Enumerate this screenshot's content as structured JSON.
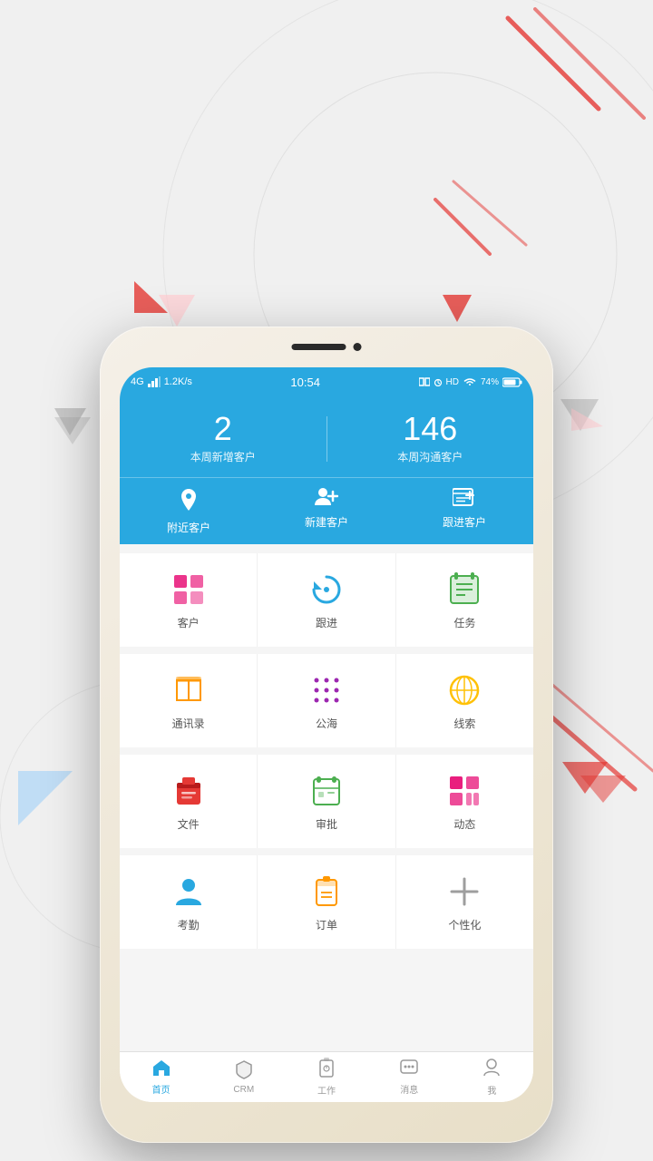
{
  "background": {
    "color": "#efefef"
  },
  "status_bar": {
    "network": "4G",
    "signal": "il",
    "speed": "1.2K/s",
    "time": "10:54",
    "battery": "74%",
    "wifi": "HD"
  },
  "stats": {
    "left_number": "2",
    "left_label": "本周新增客户",
    "right_number": "146",
    "right_label": "本周沟通客户"
  },
  "quick_actions": [
    {
      "id": "nearby",
      "label": "附近客户",
      "icon": "📍"
    },
    {
      "id": "new_customer",
      "label": "新建客户",
      "icon": "👥"
    },
    {
      "id": "follow",
      "label": "跟进客户",
      "icon": "📋"
    }
  ],
  "grid_rows": [
    [
      {
        "id": "customer",
        "label": "客户",
        "color": "#e91e7e",
        "icon": "grid"
      },
      {
        "id": "follow_up",
        "label": "跟进",
        "color": "#29a8e0",
        "icon": "refresh"
      },
      {
        "id": "task",
        "label": "任务",
        "color": "#4caf50",
        "icon": "task"
      }
    ],
    [
      {
        "id": "contacts",
        "label": "通讯录",
        "color": "#ff9800",
        "icon": "book"
      },
      {
        "id": "public_sea",
        "label": "公海",
        "color": "#9c27b0",
        "icon": "dots"
      },
      {
        "id": "leads",
        "label": "线索",
        "color": "#ffc107",
        "icon": "globe"
      }
    ],
    [
      {
        "id": "files",
        "label": "文件",
        "color": "#e53935",
        "icon": "briefcase"
      },
      {
        "id": "approval",
        "label": "审批",
        "color": "#4caf50",
        "icon": "calendar"
      },
      {
        "id": "dynamic",
        "label": "动态",
        "color": "#e91e7e",
        "icon": "grid4"
      }
    ],
    [
      {
        "id": "attendance",
        "label": "考勤",
        "color": "#29a8e0",
        "icon": "person"
      },
      {
        "id": "order",
        "label": "订单",
        "color": "#ff9800",
        "icon": "clipboard"
      },
      {
        "id": "customize",
        "label": "个性化",
        "color": "#9e9e9e",
        "icon": "plus"
      }
    ]
  ],
  "tabs": [
    {
      "id": "home",
      "label": "首页",
      "active": true,
      "icon": "home"
    },
    {
      "id": "crm",
      "label": "CRM",
      "active": false,
      "icon": "shield"
    },
    {
      "id": "work",
      "label": "工作",
      "active": false,
      "icon": "lock"
    },
    {
      "id": "messages",
      "label": "消息",
      "active": false,
      "icon": "chat"
    },
    {
      "id": "me",
      "label": "我",
      "active": false,
      "icon": "person"
    }
  ]
}
